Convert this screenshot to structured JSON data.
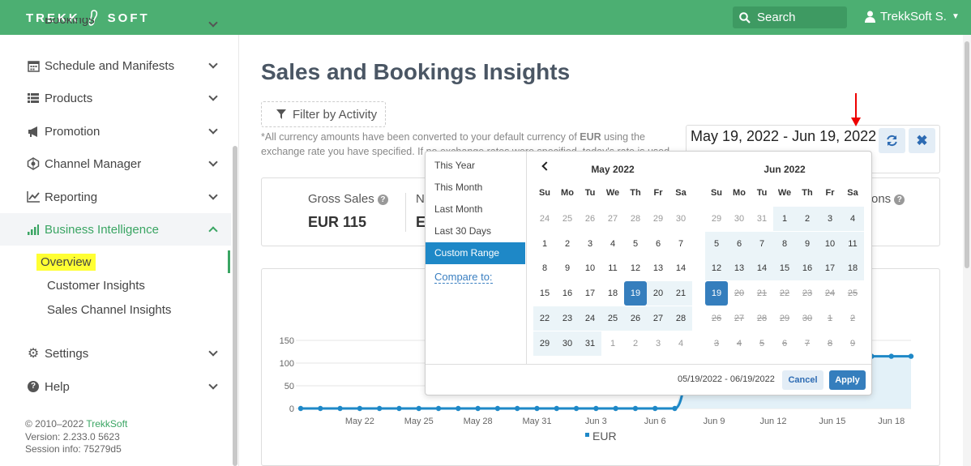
{
  "header": {
    "logo_left": "TREKK",
    "logo_right": "SOFT",
    "search_label": "Search",
    "user_label": "TrekkSoft S."
  },
  "sidebar": {
    "items": [
      {
        "label": "Bookings"
      },
      {
        "label": "Schedule and Manifests"
      },
      {
        "label": "Products"
      },
      {
        "label": "Promotion"
      },
      {
        "label": "Channel Manager"
      },
      {
        "label": "Reporting"
      },
      {
        "label": "Business Intelligence"
      },
      {
        "label": "Settings"
      },
      {
        "label": "Help"
      }
    ],
    "subitems": [
      "Overview",
      "Customer Insights",
      "Sales Channel Insights"
    ],
    "footer_copyright": "© 2010–2022",
    "footer_brand": "TrekkSoft",
    "footer_version": "Version: 2.233.0 5623",
    "footer_session": "Session info: 75279d5"
  },
  "page": {
    "title": "Sales and Bookings Insights",
    "filter_label": "Filter by Activity",
    "note_a": "*All currency amounts have been converted to your default currency of ",
    "note_currency": "EUR",
    "note_b": " using the exchange rate you have specified. If no exchange rates were specified, today's rate is used.",
    "date_range": "May 19, 2022 - Jun 19, 2022"
  },
  "stats": {
    "gross_label": "Gross Sales",
    "gross_value": "EUR 115",
    "net_label": "N",
    "net_value": "E",
    "other_label": "ons"
  },
  "picker": {
    "ranges": [
      "This Year",
      "This Month",
      "Last Month",
      "Last 30 Days",
      "Custom Range"
    ],
    "selected_range": "Custom Range",
    "compare_label": "Compare to:",
    "dow": [
      "Su",
      "Mo",
      "Tu",
      "We",
      "Th",
      "Fr",
      "Sa"
    ],
    "left_month": "May 2022",
    "right_month": "Jun 2022",
    "left_days": [
      [
        "24",
        "25",
        "26",
        "27",
        "28",
        "29",
        "30"
      ],
      [
        "1",
        "2",
        "3",
        "4",
        "5",
        "6",
        "7"
      ],
      [
        "8",
        "9",
        "10",
        "11",
        "12",
        "13",
        "14"
      ],
      [
        "15",
        "16",
        "17",
        "18",
        "19",
        "20",
        "21"
      ],
      [
        "22",
        "23",
        "24",
        "25",
        "26",
        "27",
        "28"
      ],
      [
        "29",
        "30",
        "31",
        "1",
        "2",
        "3",
        "4"
      ]
    ],
    "right_days": [
      [
        "29",
        "30",
        "31",
        "1",
        "2",
        "3",
        "4"
      ],
      [
        "5",
        "6",
        "7",
        "8",
        "9",
        "10",
        "11"
      ],
      [
        "12",
        "13",
        "14",
        "15",
        "16",
        "17",
        "18"
      ],
      [
        "19",
        "20",
        "21",
        "22",
        "23",
        "24",
        "25"
      ],
      [
        "26",
        "27",
        "28",
        "29",
        "30",
        "1",
        "2"
      ],
      [
        "3",
        "4",
        "5",
        "6",
        "7",
        "8",
        "9"
      ]
    ],
    "selection_text": "05/19/2022 - 06/19/2022",
    "cancel_label": "Cancel",
    "apply_label": "Apply"
  },
  "colors": {
    "brand": "#4caf72",
    "accent": "#357ebd",
    "highlight": "#ffff33"
  },
  "chart_data": {
    "type": "area",
    "x_ticks": [
      "May 22",
      "May 25",
      "May 28",
      "May 31",
      "Jun 3",
      "Jun 6",
      "Jun 9",
      "Jun 12",
      "Jun 15",
      "Jun 18"
    ],
    "y_ticks": [
      0,
      50,
      100,
      150
    ],
    "ylim": [
      0,
      150
    ],
    "series": [
      {
        "name": "EUR",
        "x": [
          "May 19",
          "May 20",
          "May 21",
          "May 22",
          "May 23",
          "May 24",
          "May 25",
          "May 26",
          "May 27",
          "May 28",
          "May 29",
          "May 30",
          "May 31",
          "Jun 1",
          "Jun 2",
          "Jun 3",
          "Jun 4",
          "Jun 5",
          "Jun 6",
          "Jun 7",
          "Jun 8",
          "Jun 9",
          "Jun 10",
          "Jun 11",
          "Jun 12",
          "Jun 13",
          "Jun 14",
          "Jun 15",
          "Jun 16",
          "Jun 17",
          "Jun 18",
          "Jun 19"
        ],
        "values": [
          0,
          0,
          0,
          0,
          0,
          0,
          0,
          0,
          0,
          0,
          0,
          0,
          0,
          0,
          0,
          0,
          0,
          0,
          0,
          0,
          115,
          115,
          115,
          115,
          115,
          115,
          115,
          115,
          115,
          115,
          115,
          115
        ]
      }
    ]
  }
}
